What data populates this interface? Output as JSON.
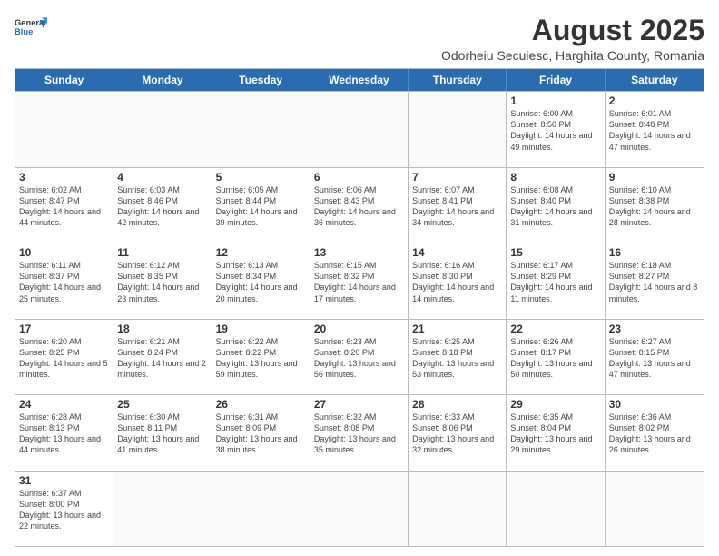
{
  "header": {
    "logo_general": "General",
    "logo_blue": "Blue",
    "main_title": "August 2025",
    "subtitle": "Odorheiu Secuiesc, Harghita County, Romania"
  },
  "calendar": {
    "weekdays": [
      "Sunday",
      "Monday",
      "Tuesday",
      "Wednesday",
      "Thursday",
      "Friday",
      "Saturday"
    ],
    "rows": [
      [
        {
          "day": "",
          "info": ""
        },
        {
          "day": "",
          "info": ""
        },
        {
          "day": "",
          "info": ""
        },
        {
          "day": "",
          "info": ""
        },
        {
          "day": "",
          "info": ""
        },
        {
          "day": "1",
          "info": "Sunrise: 6:00 AM\nSunset: 8:50 PM\nDaylight: 14 hours and 49 minutes."
        },
        {
          "day": "2",
          "info": "Sunrise: 6:01 AM\nSunset: 8:48 PM\nDaylight: 14 hours and 47 minutes."
        }
      ],
      [
        {
          "day": "3",
          "info": "Sunrise: 6:02 AM\nSunset: 8:47 PM\nDaylight: 14 hours and 44 minutes."
        },
        {
          "day": "4",
          "info": "Sunrise: 6:03 AM\nSunset: 8:46 PM\nDaylight: 14 hours and 42 minutes."
        },
        {
          "day": "5",
          "info": "Sunrise: 6:05 AM\nSunset: 8:44 PM\nDaylight: 14 hours and 39 minutes."
        },
        {
          "day": "6",
          "info": "Sunrise: 6:06 AM\nSunset: 8:43 PM\nDaylight: 14 hours and 36 minutes."
        },
        {
          "day": "7",
          "info": "Sunrise: 6:07 AM\nSunset: 8:41 PM\nDaylight: 14 hours and 34 minutes."
        },
        {
          "day": "8",
          "info": "Sunrise: 6:08 AM\nSunset: 8:40 PM\nDaylight: 14 hours and 31 minutes."
        },
        {
          "day": "9",
          "info": "Sunrise: 6:10 AM\nSunset: 8:38 PM\nDaylight: 14 hours and 28 minutes."
        }
      ],
      [
        {
          "day": "10",
          "info": "Sunrise: 6:11 AM\nSunset: 8:37 PM\nDaylight: 14 hours and 25 minutes."
        },
        {
          "day": "11",
          "info": "Sunrise: 6:12 AM\nSunset: 8:35 PM\nDaylight: 14 hours and 23 minutes."
        },
        {
          "day": "12",
          "info": "Sunrise: 6:13 AM\nSunset: 8:34 PM\nDaylight: 14 hours and 20 minutes."
        },
        {
          "day": "13",
          "info": "Sunrise: 6:15 AM\nSunset: 8:32 PM\nDaylight: 14 hours and 17 minutes."
        },
        {
          "day": "14",
          "info": "Sunrise: 6:16 AM\nSunset: 8:30 PM\nDaylight: 14 hours and 14 minutes."
        },
        {
          "day": "15",
          "info": "Sunrise: 6:17 AM\nSunset: 8:29 PM\nDaylight: 14 hours and 11 minutes."
        },
        {
          "day": "16",
          "info": "Sunrise: 6:18 AM\nSunset: 8:27 PM\nDaylight: 14 hours and 8 minutes."
        }
      ],
      [
        {
          "day": "17",
          "info": "Sunrise: 6:20 AM\nSunset: 8:25 PM\nDaylight: 14 hours and 5 minutes."
        },
        {
          "day": "18",
          "info": "Sunrise: 6:21 AM\nSunset: 8:24 PM\nDaylight: 14 hours and 2 minutes."
        },
        {
          "day": "19",
          "info": "Sunrise: 6:22 AM\nSunset: 8:22 PM\nDaylight: 13 hours and 59 minutes."
        },
        {
          "day": "20",
          "info": "Sunrise: 6:23 AM\nSunset: 8:20 PM\nDaylight: 13 hours and 56 minutes."
        },
        {
          "day": "21",
          "info": "Sunrise: 6:25 AM\nSunset: 8:18 PM\nDaylight: 13 hours and 53 minutes."
        },
        {
          "day": "22",
          "info": "Sunrise: 6:26 AM\nSunset: 8:17 PM\nDaylight: 13 hours and 50 minutes."
        },
        {
          "day": "23",
          "info": "Sunrise: 6:27 AM\nSunset: 8:15 PM\nDaylight: 13 hours and 47 minutes."
        }
      ],
      [
        {
          "day": "24",
          "info": "Sunrise: 6:28 AM\nSunset: 8:13 PM\nDaylight: 13 hours and 44 minutes."
        },
        {
          "day": "25",
          "info": "Sunrise: 6:30 AM\nSunset: 8:11 PM\nDaylight: 13 hours and 41 minutes."
        },
        {
          "day": "26",
          "info": "Sunrise: 6:31 AM\nSunset: 8:09 PM\nDaylight: 13 hours and 38 minutes."
        },
        {
          "day": "27",
          "info": "Sunrise: 6:32 AM\nSunset: 8:08 PM\nDaylight: 13 hours and 35 minutes."
        },
        {
          "day": "28",
          "info": "Sunrise: 6:33 AM\nSunset: 8:06 PM\nDaylight: 13 hours and 32 minutes."
        },
        {
          "day": "29",
          "info": "Sunrise: 6:35 AM\nSunset: 8:04 PM\nDaylight: 13 hours and 29 minutes."
        },
        {
          "day": "30",
          "info": "Sunrise: 6:36 AM\nSunset: 8:02 PM\nDaylight: 13 hours and 26 minutes."
        }
      ],
      [
        {
          "day": "31",
          "info": "Sunrise: 6:37 AM\nSunset: 8:00 PM\nDaylight: 13 hours and 22 minutes."
        },
        {
          "day": "",
          "info": ""
        },
        {
          "day": "",
          "info": ""
        },
        {
          "day": "",
          "info": ""
        },
        {
          "day": "",
          "info": ""
        },
        {
          "day": "",
          "info": ""
        },
        {
          "day": "",
          "info": ""
        }
      ]
    ]
  }
}
